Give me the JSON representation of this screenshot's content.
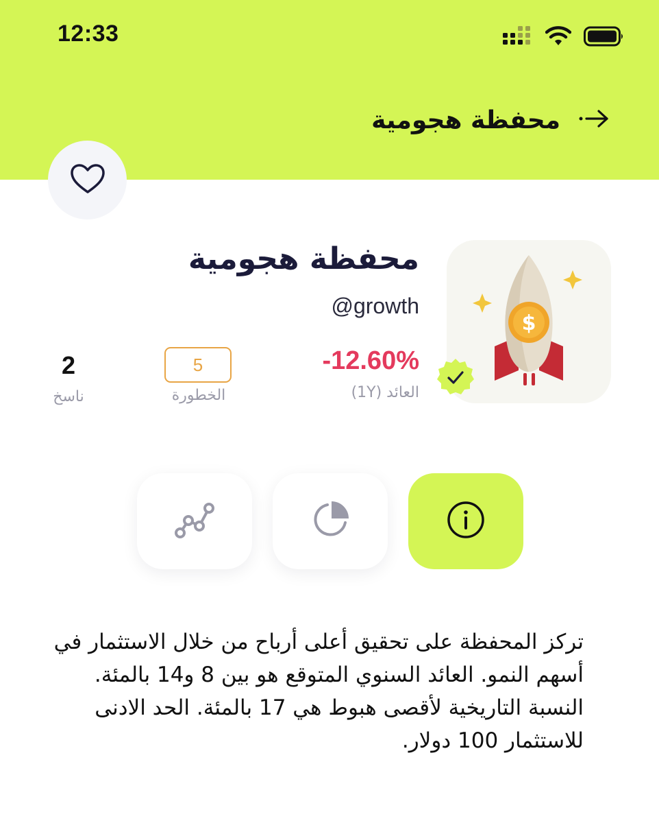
{
  "status_bar": {
    "time": "12:33",
    "icons": [
      "signal-icon",
      "wifi-icon",
      "battery-icon"
    ]
  },
  "header": {
    "title": "محفظة هجومية",
    "back_icon": "arrow-right-icon",
    "background_color": "#d4f555"
  },
  "favorite": {
    "icon": "heart-icon"
  },
  "portfolio": {
    "name": "محفظة هجومية",
    "handle": "@growth",
    "avatar_icon": "rocket-dollar-icon",
    "verified_icon": "check-badge-icon"
  },
  "stats": {
    "return_value": "-12.60%",
    "return_label": "العائد (1Y)",
    "risk_value": "5",
    "risk_label": "الخطورة",
    "copiers_value": "2",
    "copiers_label": "ناسخ"
  },
  "tabs": [
    {
      "icon": "info-icon",
      "active": true
    },
    {
      "icon": "pie-chart-icon",
      "active": false
    },
    {
      "icon": "line-chart-icon",
      "active": false
    }
  ],
  "description": "تركز المحفظة على تحقيق أعلى أرباح من خلال الاستثمار في أسهم النمو. العائد السنوي المتوقع هو بين 8 و14 بالمئة. النسبة التاريخية لأقصى هبوط هي 17 بالمئة. الحد الادنى للاستثمار 100 دولار.",
  "colors": {
    "accent": "#d4f555",
    "negative": "#e43a5d",
    "risk": "#e8a545",
    "muted": "#9a9aa8"
  }
}
